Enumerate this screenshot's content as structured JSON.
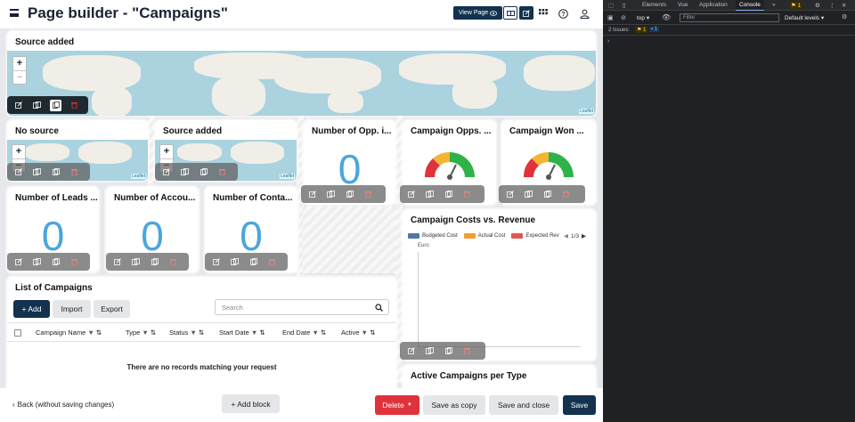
{
  "header": {
    "title": "Page builder - \"Campaigns\"",
    "view_page_label": "View Page"
  },
  "widgets": {
    "source_added_top": {
      "title": "Source added",
      "map_attribution": "Leaflet"
    },
    "no_source": {
      "title": "No source",
      "map_attribution": "Leaflet"
    },
    "source_added_small": {
      "title": "Source added",
      "map_attribution": "Leaflet"
    },
    "opp_count": {
      "title": "Number of Opp. i...",
      "value": "0"
    },
    "campaign_opps": {
      "title": "Campaign Opps. ..."
    },
    "campaign_won": {
      "title": "Campaign Won ..."
    },
    "leads": {
      "title": "Number of Leads ...",
      "value": "0"
    },
    "accounts": {
      "title": "Number of Accou...",
      "value": "0"
    },
    "contacts": {
      "title": "Number of Conta...",
      "value": "0"
    },
    "costs_revenue": {
      "title": "Campaign Costs vs. Revenue",
      "legend": [
        {
          "label": "Budgeted Cost",
          "color": "#4e79a7"
        },
        {
          "label": "Actual Cost",
          "color": "#f0a030"
        },
        {
          "label": "Expected Rev",
          "color": "#e05759"
        }
      ],
      "page": "1/3",
      "y_unit": "Euro"
    },
    "active_campaigns": {
      "title": "Active Campaigns per Type"
    }
  },
  "chart_data": {
    "type": "bar",
    "title": "Campaign Costs vs. Revenue",
    "ylabel": "Euro",
    "series": [
      {
        "name": "Budgeted Cost",
        "values": []
      },
      {
        "name": "Actual Cost",
        "values": []
      },
      {
        "name": "Expected Rev",
        "values": []
      }
    ]
  },
  "list": {
    "title": "List of Campaigns",
    "add_label": "+ Add",
    "import_label": "Import",
    "export_label": "Export",
    "search_placeholder": "Search",
    "columns": [
      "Campaign Name",
      "Type",
      "Status",
      "Start Date",
      "End Date",
      "Active"
    ],
    "empty_text": "There are no records matching your request"
  },
  "footer": {
    "back_label": "Back (without saving changes)",
    "add_block_label": "+ Add block",
    "delete_label": "Delete",
    "save_copy_label": "Save as copy",
    "save_close_label": "Save and close",
    "save_label": "Save"
  },
  "devtools": {
    "tabs": [
      "Elements",
      "Vue",
      "Application",
      "Console"
    ],
    "active_tab": "Console",
    "badge_count": "1",
    "context": "top",
    "filter_placeholder": "Filter",
    "levels": "Default levels",
    "issues_label": "2 Issues:",
    "issues_warn": "1",
    "issues_info": "1"
  },
  "colors": {
    "primary": "#12324f",
    "number": "#4aa6de",
    "danger": "#e0323c",
    "gauge_red": "#e0323c",
    "gauge_yellow": "#f2b632",
    "gauge_green": "#2eb24a"
  }
}
